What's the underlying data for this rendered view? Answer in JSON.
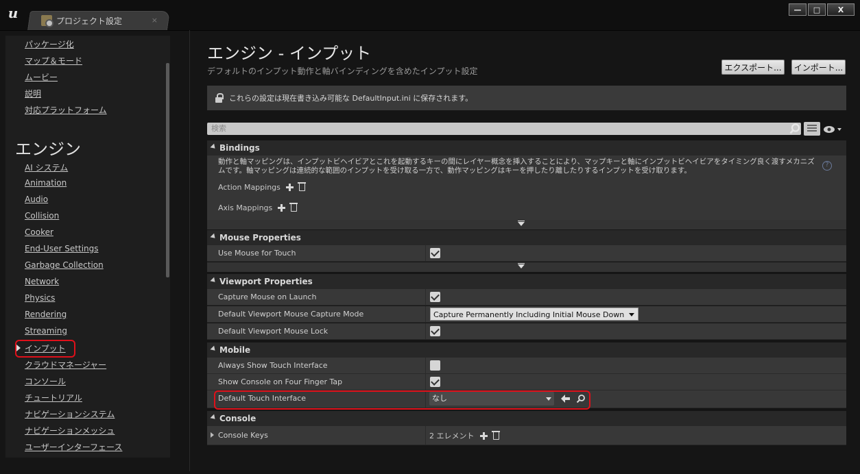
{
  "window": {
    "logo": "u",
    "tab_title": "プロジェクト設定",
    "tab_close": "×",
    "minimize": "—",
    "maximize": "□",
    "close": "X"
  },
  "sidebar": {
    "top_items": [
      "パッケージ化",
      "マップ＆モード",
      "ムービー",
      "説明",
      "対応プラットフォーム"
    ],
    "section_title": "エンジン",
    "items": [
      "AI システム",
      "Animation",
      "Audio",
      "Collision",
      "Cooker",
      "End-User Settings",
      "Garbage Collection",
      "Network",
      "Physics",
      "Rendering",
      "Streaming",
      "インプット",
      "クラウドマネージャー",
      "コンソール",
      "チュートリアル",
      "ナビゲーションシステム",
      "ナビゲーションメッシュ",
      "ユーザーインターフェース"
    ],
    "selected": "インプット"
  },
  "header": {
    "title": "エンジン - インプット",
    "subtitle": "デフォルトのインプット動作と軸バインディングを含めたインプット設定",
    "export_label": "エクスポート...",
    "import_label": "インポート..."
  },
  "notice": {
    "text": "これらの設定は現在書き込み可能な DefaultInput.ini に保存されます。"
  },
  "search": {
    "placeholder": "検索"
  },
  "sections": {
    "bindings": {
      "title": "Bindings",
      "description": "動作と軸マッピングは、インプットビヘイビアとこれを起動するキーの間にレイヤー概念を挿入することにより、マップキーと軸にインプットビヘイビアをタイミング良く渡すメカニズムです。軸マッピングは連続的な範囲のインプットを受け取る一方で、動作マッピングはキーを押したり離したりするインプットを受け取ります。",
      "action_mappings": "Action Mappings",
      "axis_mappings": "Axis Mappings",
      "help": "?"
    },
    "mouse": {
      "title": "Mouse Properties",
      "use_mouse_for_touch": "Use Mouse for Touch"
    },
    "viewport": {
      "title": "Viewport Properties",
      "capture_mouse_on_launch": "Capture Mouse on Launch",
      "capture_mode_label": "Default Viewport Mouse Capture Mode",
      "capture_mode_value": "Capture Permanently Including Initial Mouse Down",
      "mouse_lock": "Default Viewport Mouse Lock"
    },
    "mobile": {
      "title": "Mobile",
      "always_show_touch": "Always Show Touch Interface",
      "show_console_four_finger": "Show Console on Four Finger Tap",
      "default_touch_interface": "Default Touch Interface",
      "default_touch_value": "なし"
    },
    "console": {
      "title": "Console",
      "console_keys": "Console Keys",
      "console_keys_value": "2 エレメント"
    }
  },
  "colors": {
    "highlight": "#e0101a",
    "background": "#151515",
    "panel": "#383838"
  }
}
